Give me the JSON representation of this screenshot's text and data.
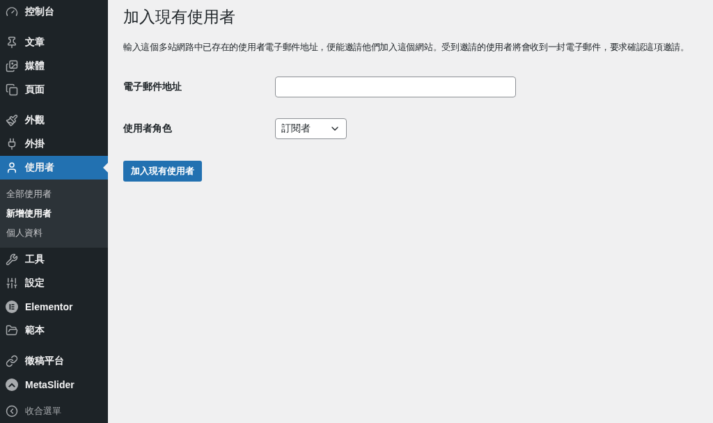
{
  "sidebar": {
    "groups": [
      [
        {
          "label": "控制台",
          "selected": false
        }
      ],
      [
        {
          "label": "文章",
          "selected": false
        },
        {
          "label": "媒體",
          "selected": false
        },
        {
          "label": "頁面",
          "selected": false
        }
      ],
      [
        {
          "label": "外觀",
          "selected": false
        },
        {
          "label": "外掛",
          "selected": false
        },
        {
          "label": "使用者",
          "selected": true,
          "children": [
            {
              "label": "全部使用者",
              "selected": false
            },
            {
              "label": "新增使用者",
              "selected": true
            },
            {
              "label": "個人資料",
              "selected": false
            }
          ]
        },
        {
          "label": "工具",
          "selected": false
        },
        {
          "label": "設定",
          "selected": false
        },
        {
          "label": "Elementor",
          "selected": false
        },
        {
          "label": "範本",
          "selected": false
        }
      ],
      [
        {
          "label": "徵稿平台",
          "selected": false
        },
        {
          "label": "MetaSlider",
          "selected": false
        }
      ]
    ],
    "collapse": "收合選單"
  },
  "page": {
    "title": "加入現有使用者",
    "description": "輸入這個多站網路中已存在的使用者電子郵件地址，便能邀請他們加入這個網站。受到邀請的使用者將會收到一封電子郵件，要求確認這項邀請。",
    "fields": [
      {
        "kind": "text",
        "label": "電子郵件地址"
      },
      {
        "kind": "select",
        "label": "使用者角色",
        "value": "訂閱者"
      }
    ],
    "submit": "加入現有使用者"
  }
}
